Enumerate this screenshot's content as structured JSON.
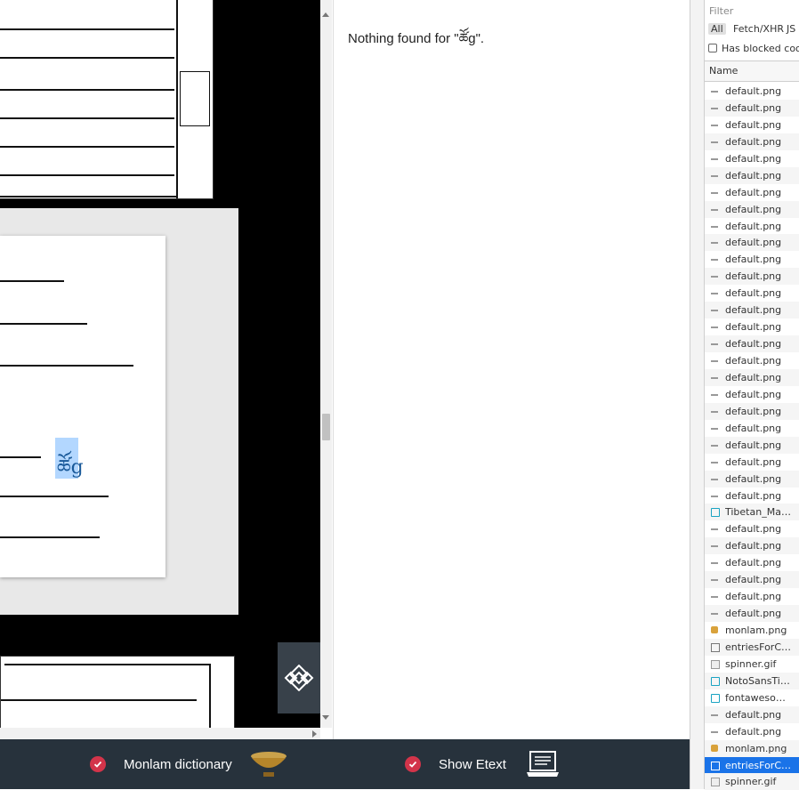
{
  "search": {
    "message": "Nothing found for \"ཚོg\".",
    "highlight_text": "ཚོg"
  },
  "devtools": {
    "filter_placeholder": "Filter",
    "types": [
      "All",
      "Fetch/XHR",
      "JS"
    ],
    "blocked_cookies": "Has blocked cook",
    "column_name": "Name",
    "requests": [
      {
        "name": "default.png",
        "kind": "png"
      },
      {
        "name": "default.png",
        "kind": "png"
      },
      {
        "name": "default.png",
        "kind": "png"
      },
      {
        "name": "default.png",
        "kind": "png"
      },
      {
        "name": "default.png",
        "kind": "png"
      },
      {
        "name": "default.png",
        "kind": "png"
      },
      {
        "name": "default.png",
        "kind": "png"
      },
      {
        "name": "default.png",
        "kind": "png"
      },
      {
        "name": "default.png",
        "kind": "png"
      },
      {
        "name": "default.png",
        "kind": "png"
      },
      {
        "name": "default.png",
        "kind": "png"
      },
      {
        "name": "default.png",
        "kind": "png"
      },
      {
        "name": "default.png",
        "kind": "png"
      },
      {
        "name": "default.png",
        "kind": "png"
      },
      {
        "name": "default.png",
        "kind": "png"
      },
      {
        "name": "default.png",
        "kind": "png"
      },
      {
        "name": "default.png",
        "kind": "png"
      },
      {
        "name": "default.png",
        "kind": "png"
      },
      {
        "name": "default.png",
        "kind": "png"
      },
      {
        "name": "default.png",
        "kind": "png"
      },
      {
        "name": "default.png",
        "kind": "png"
      },
      {
        "name": "default.png",
        "kind": "png"
      },
      {
        "name": "default.png",
        "kind": "png"
      },
      {
        "name": "default.png",
        "kind": "png"
      },
      {
        "name": "default.png",
        "kind": "png"
      },
      {
        "name": "Tibetan_Mac...",
        "kind": "font"
      },
      {
        "name": "default.png",
        "kind": "png"
      },
      {
        "name": "default.png",
        "kind": "png"
      },
      {
        "name": "default.png",
        "kind": "png"
      },
      {
        "name": "default.png",
        "kind": "png"
      },
      {
        "name": "default.png",
        "kind": "png"
      },
      {
        "name": "default.png",
        "kind": "png"
      },
      {
        "name": "monlam.png",
        "kind": "monlam"
      },
      {
        "name": "entriesForCh...",
        "kind": "doc"
      },
      {
        "name": "spinner.gif",
        "kind": "gif"
      },
      {
        "name": "NotoSansTib...",
        "kind": "font"
      },
      {
        "name": "fontawesom...",
        "kind": "font"
      },
      {
        "name": "default.png",
        "kind": "png"
      },
      {
        "name": "default.png",
        "kind": "png"
      },
      {
        "name": "monlam.png",
        "kind": "monlam"
      },
      {
        "name": "entriesForCh...",
        "kind": "doc",
        "selected": true
      },
      {
        "name": "spinner.gif",
        "kind": "gif"
      }
    ]
  },
  "bottombar": {
    "monlam_label": "Monlam dictionary",
    "etext_label": "Show Etext"
  },
  "colors": {
    "bottombar_bg": "#27323c",
    "check_red": "#d3344a",
    "highlight": "#b3d7ff",
    "selected_row": "#1a73e8"
  }
}
